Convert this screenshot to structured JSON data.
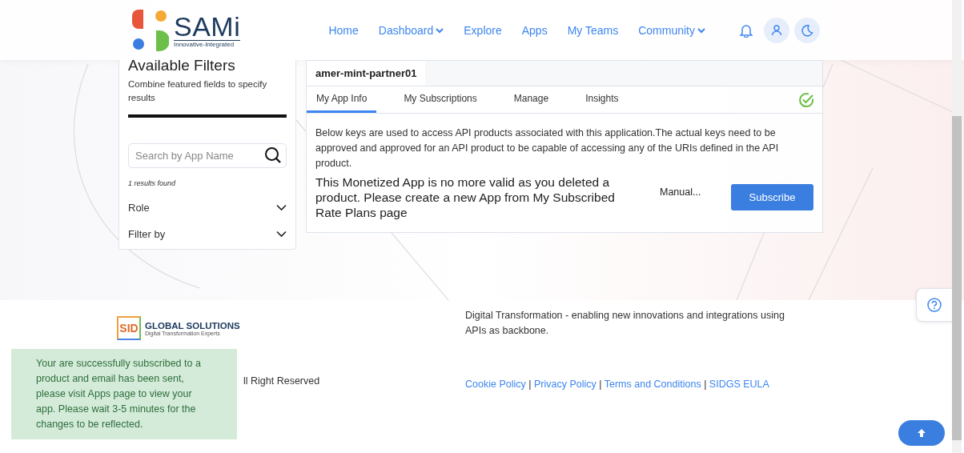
{
  "logo": {
    "name": "SAMi",
    "tagline": "Innovative-Integrated"
  },
  "nav": [
    {
      "label": "Home",
      "dropdown": false
    },
    {
      "label": "Dashboard",
      "dropdown": true
    },
    {
      "label": "Explore",
      "dropdown": false
    },
    {
      "label": "Apps",
      "dropdown": false
    },
    {
      "label": "My Teams",
      "dropdown": false
    },
    {
      "label": "Community",
      "dropdown": true
    }
  ],
  "filters": {
    "title": "Available Filters",
    "subtitle": "Combine featured fields to specify results",
    "search": {
      "placeholder": "Search by App Name"
    },
    "results": "1 results found",
    "groups": [
      {
        "label": "Role",
        "expanded": false
      },
      {
        "label": "Filter by",
        "expanded": false
      }
    ]
  },
  "app": {
    "name": "amer-mint-partner01",
    "tabs": [
      {
        "label": "My App Info",
        "selected": true
      },
      {
        "label": "My Subscriptions",
        "selected": false
      },
      {
        "label": "Manage",
        "selected": false
      },
      {
        "label": "Insights",
        "selected": false
      }
    ],
    "description": "Below keys are used to access API products associated with this application.The actual keys need to be approved and approved for an API product to be capable of accessing any of the URIs defined in the API product.",
    "notice": "This Monetized App is no more valid as you deleted a product. Please create a new App from My Subscribed Rate Plans page",
    "plan": "Manual...",
    "button": "Subscribe"
  },
  "footer": {
    "brand": {
      "mark": "SID",
      "name": "GLOBAL SOLUTIONS",
      "tagline": "Digital Transformation Experts"
    },
    "copyright": "ll Right Reserved",
    "about": "Digital Transformation - enabling new innovations and integrations using APIs as backbone.",
    "links": [
      "Cookie Policy",
      "Privacy Policy",
      "Terms and Conditions",
      "SIDGS EULA"
    ],
    "separator": "|"
  },
  "toast": {
    "message": "Your are successfully subscribed to a product and email has been sent, please visit Apps page to view your app. Please wait 3-5 minutes for the changes to be reflected."
  }
}
